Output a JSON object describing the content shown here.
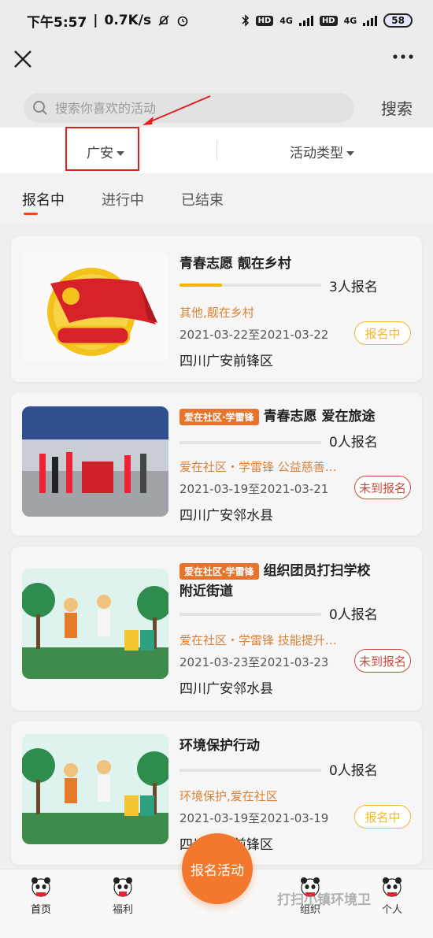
{
  "status_bar": {
    "time": "下午5:57",
    "speed": "0.7K/s",
    "net1": "4G",
    "net2": "4G",
    "hd": "HD",
    "battery": "58"
  },
  "search": {
    "placeholder": "搜索你喜欢的活动",
    "button": "搜索"
  },
  "filters": {
    "city": "广安",
    "type": "活动类型"
  },
  "tabs": [
    {
      "label": "报名中",
      "active": true
    },
    {
      "label": "进行中",
      "active": false
    },
    {
      "label": "已结束",
      "active": false
    }
  ],
  "cards": [
    {
      "tag": "",
      "title": "青春志愿 靓在乡村",
      "title2": "",
      "progress": 0.3,
      "signups": "3人报名",
      "category": "其他,靓在乡村",
      "dates": "2021-03-22至2021-03-22",
      "location": "四川广安前锋区",
      "status": "报名中"
    },
    {
      "tag": "爱在社区·学雷锋",
      "title": "青春志愿 爱在旅途",
      "title2": "",
      "progress": 0,
      "signups": "0人报名",
      "category": "爱在社区・学雷锋 公益慈善…",
      "dates": "2021-03-19至2021-03-21",
      "location": "四川广安邻水县",
      "status": "未到报名"
    },
    {
      "tag": "爱在社区·学雷锋",
      "title": "组织团员打扫学校",
      "title2": "附近街道",
      "progress": 0,
      "signups": "0人报名",
      "category": "爱在社区・学雷锋 技能提升…",
      "dates": "2021-03-23至2021-03-23",
      "location": "四川广安邻水县",
      "status": "未到报名"
    },
    {
      "tag": "",
      "title": "环境保护行动",
      "title2": "",
      "progress": 0,
      "signups": "0人报名",
      "category": "环境保护,爱在社区",
      "dates": "2021-03-19至2021-03-19",
      "location": "四川广安前锋区",
      "status": "报名中"
    }
  ],
  "ghost_title": "打扫小镇环境卫",
  "fab": "报名活动",
  "nav": [
    {
      "label": "首页"
    },
    {
      "label": "福利"
    },
    {
      "label": "组织"
    },
    {
      "label": "个人"
    }
  ],
  "colors": {
    "accent": "#f2782e",
    "tab_underline": "#e64a19",
    "status_open": "#f2b53a",
    "status_pending": "#c94a3c",
    "category_text": "#d9823a",
    "highlight_box": "#e02020"
  }
}
